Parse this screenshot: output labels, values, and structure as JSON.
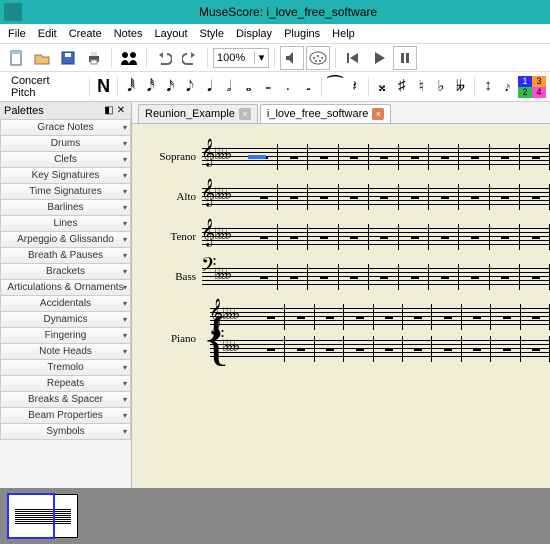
{
  "app": {
    "title": "MuseScore: i_love_free_software"
  },
  "menu": [
    "File",
    "Edit",
    "Create",
    "Notes",
    "Layout",
    "Style",
    "Display",
    "Plugins",
    "Help"
  ],
  "toolbar": {
    "zoom": "100%"
  },
  "note_toolbar": {
    "concert_pitch": "Concert Pitch"
  },
  "voices": {
    "v1": "1",
    "v2": "2",
    "v3": "3",
    "v4": "4"
  },
  "palettes": {
    "title": "Palettes",
    "items": [
      "Grace Notes",
      "Drums",
      "Clefs",
      "Key Signatures",
      "Time Signatures",
      "Barlines",
      "Lines",
      "Arpeggio & Glissando",
      "Breath & Pauses",
      "Brackets",
      "Articulations & Ornaments",
      "Accidentals",
      "Dynamics",
      "Fingering",
      "Note Heads",
      "Tremolo",
      "Repeats",
      "Breaks & Spacer",
      "Beam Properties",
      "Symbols"
    ]
  },
  "tabs": [
    {
      "label": "Reunion_Example",
      "active": false
    },
    {
      "label": "i_love_free_software",
      "active": true
    }
  ],
  "score": {
    "parts": [
      "Soprano",
      "Alto",
      "Tenor",
      "Bass",
      "Piano"
    ],
    "measures": 10
  }
}
